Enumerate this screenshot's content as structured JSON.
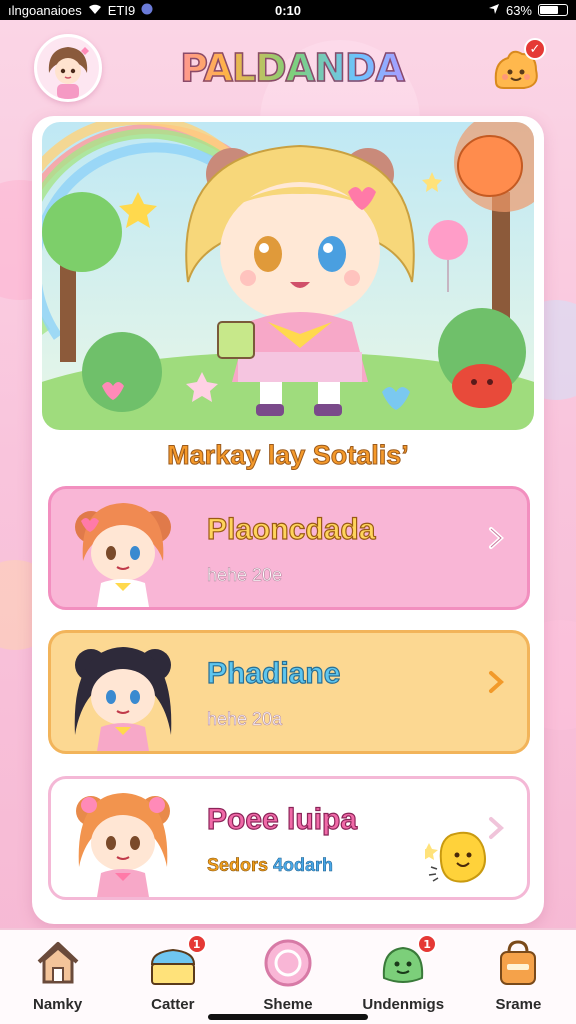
{
  "status_bar": {
    "carrier": "ılngoanaioes",
    "network": "ETI9",
    "time": "0:10",
    "battery_percent": "63%",
    "battery_level": 0.63
  },
  "header": {
    "app_title": "PALDANDA",
    "avatar_icon": "girl-avatar-icon",
    "notification_icon": "smile-bun-icon",
    "notification_badge": "✓"
  },
  "featured": {
    "hero_icon": "chibi-girl-hero-illustration",
    "title": "Markay lay Sotalis’"
  },
  "list": [
    {
      "name": "Plaoncdada",
      "subtitle": "hehe 20e",
      "subtitle_accent": "",
      "avatar_icon": "redhead-chibi-avatar-icon",
      "color": "#f9b6d6"
    },
    {
      "name": "Phadiane",
      "subtitle": "hehe 20a",
      "subtitle_accent": "",
      "avatar_icon": "darkhair-chibi-avatar-icon",
      "color": "#fcd892"
    },
    {
      "name": "Poee luipa",
      "subtitle": "Sedors ",
      "subtitle_accent": "4odarh",
      "avatar_icon": "ginger-chibi-avatar-icon",
      "color": "#ffffff"
    }
  ],
  "bottom_nav": [
    {
      "label": "Namky",
      "icon": "house-icon",
      "badge": ""
    },
    {
      "label": "Catter",
      "icon": "cake-icon",
      "badge": "1"
    },
    {
      "label": "Sheme",
      "icon": "circle-gem-icon",
      "badge": ""
    },
    {
      "label": "Undenmigs",
      "icon": "slime-icon",
      "badge": "1"
    },
    {
      "label": "Srame",
      "icon": "bag-icon",
      "badge": ""
    }
  ]
}
